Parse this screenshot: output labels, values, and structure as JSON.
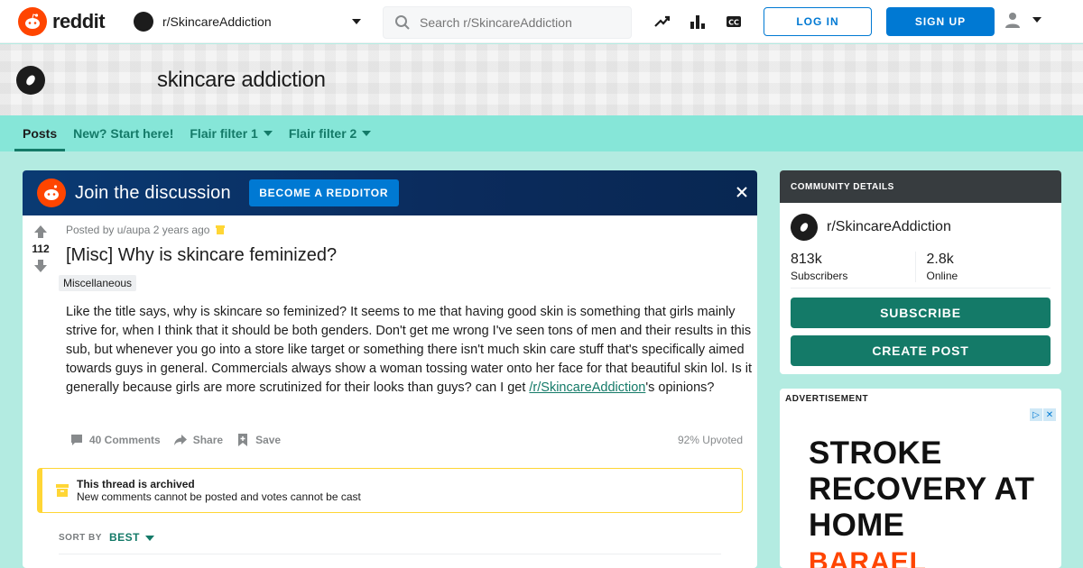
{
  "header": {
    "brand": "reddit",
    "subreddit": "r/SkincareAddiction",
    "search_placeholder": "Search r/SkincareAddiction",
    "login_label": "LOG IN",
    "signup_label": "SIGN UP",
    "icons": [
      "trending-icon",
      "stats-icon",
      "closed-captions-icon",
      "user-icon",
      "chevron-down-icon"
    ]
  },
  "banner": {
    "title": "skincare addiction"
  },
  "subnav": {
    "items": [
      "Posts",
      "New? Start here!",
      "Flair filter 1",
      "Flair filter 2"
    ]
  },
  "join": {
    "text": "Join the discussion",
    "button_label": "BECOME A REDDITOR"
  },
  "post": {
    "votes": "112",
    "meta": "Posted by u/aupa 2 years ago",
    "title": "[Misc] Why is skincare feminized?",
    "flair": "Miscellaneous",
    "body": "Like the title says, why is skincare so feminized? It seems to me that having good skin is something that girls mainly strive for, when I think that it should be both genders. Don't get me wrong I've seen tons of men and their results in this sub, but whenever you go into a store like target or something there isn't much skin care stuff that's specifically aimed towards guys in general. Commercials always show a woman tossing water onto her face for that beautiful skin lol. Is it generally because girls are more scrutinized for their looks than guys? can I get ",
    "body_link": "/r/SkincareAddiction",
    "body_tail": "'s opinions?",
    "comments_label": "40 Comments",
    "share_label": "Share",
    "save_label": "Save",
    "upvoted": "92% Upvoted"
  },
  "archived": {
    "title": "This thread is archived",
    "desc": "New comments cannot be posted and votes cannot be cast"
  },
  "sort": {
    "label": "SORT BY",
    "value": "BEST"
  },
  "community": {
    "heading": "COMMUNITY DETAILS",
    "name": "r/SkincareAddiction",
    "subscribers_value": "813k",
    "subscribers_label": "Subscribers",
    "online_value": "2.8k",
    "online_label": "Online",
    "subscribe_label": "SUBSCRIBE",
    "create_label": "CREATE POST"
  },
  "ad": {
    "label": "ADVERTISEMENT",
    "headline": "STROKE RECOVERY AT HOME",
    "sub": "BARAEL"
  },
  "colors": {
    "accent": "#147a68",
    "brand": "#ff4500",
    "blue": "#0079d3",
    "subnav": "#86e6d8",
    "page_bg": "#b3ebe1"
  }
}
